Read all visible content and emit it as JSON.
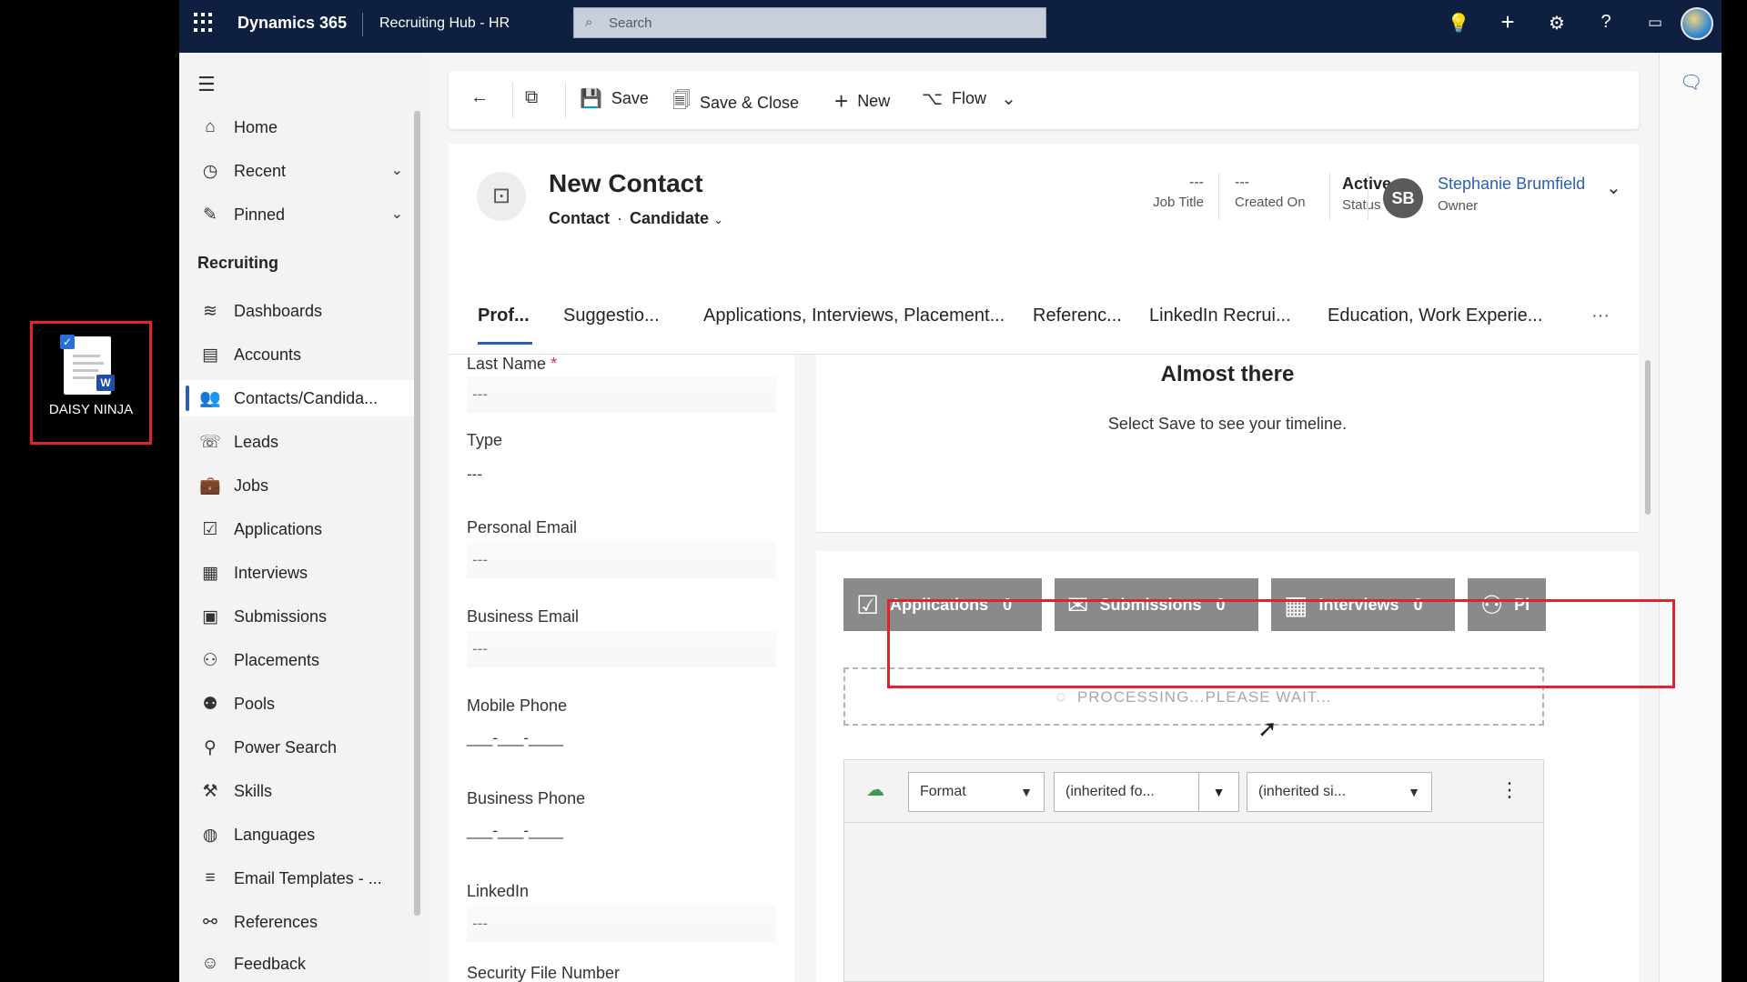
{
  "desktop": {
    "icon_label": "DAISY NINJA"
  },
  "topbar": {
    "brand": "Dynamics 365",
    "app_name": "Recruiting Hub - HR",
    "search_placeholder": "Search"
  },
  "sidebar": {
    "items_top": [
      {
        "label": "Home",
        "icon": "home-icon"
      },
      {
        "label": "Recent",
        "icon": "clock-icon",
        "expandable": true
      },
      {
        "label": "Pinned",
        "icon": "pin-icon",
        "expandable": true
      }
    ],
    "section_title": "Recruiting",
    "items": [
      {
        "label": "Dashboards"
      },
      {
        "label": "Accounts"
      },
      {
        "label": "Contacts/Candida...",
        "active": true
      },
      {
        "label": "Leads"
      },
      {
        "label": "Jobs"
      },
      {
        "label": "Applications"
      },
      {
        "label": "Interviews"
      },
      {
        "label": "Submissions"
      },
      {
        "label": "Placements"
      },
      {
        "label": "Pools"
      },
      {
        "label": "Power Search"
      },
      {
        "label": "Skills"
      },
      {
        "label": "Languages"
      },
      {
        "label": "Email Templates - ..."
      },
      {
        "label": "References"
      },
      {
        "label": "Feedback"
      }
    ]
  },
  "commandbar": {
    "save": "Save",
    "save_close": "Save & Close",
    "new": "New",
    "flow": "Flow"
  },
  "record": {
    "title": "New Contact",
    "entity": "Contact",
    "form": "Candidate",
    "job_title_value": "---",
    "job_title_label": "Job Title",
    "created_on_value": "---",
    "created_on_label": "Created On",
    "status_value": "Active",
    "status_label": "Status",
    "owner_initials": "SB",
    "owner_name": "Stephanie Brumfield",
    "owner_label": "Owner"
  },
  "tabs": [
    "Prof...",
    "Suggestio...",
    "Applications, Interviews, Placement...",
    "Referenc...",
    "LinkedIn Recrui...",
    "Education, Work Experie...",
    "···"
  ],
  "form": {
    "last_name_label": "Last Name",
    "last_name_value": "---",
    "type_label": "Type",
    "type_value": "---",
    "personal_email_label": "Personal Email",
    "personal_email_value": "---",
    "business_email_label": "Business Email",
    "business_email_value": "---",
    "mobile_phone_label": "Mobile Phone",
    "mobile_phone_value": "___-___-____",
    "business_phone_label": "Business Phone",
    "business_phone_value": "___-___-____",
    "linkedin_label": "LinkedIn",
    "linkedin_value": "---",
    "security_label": "Security File Number"
  },
  "timeline": {
    "title": "Almost there",
    "subtitle": "Select Save to see your timeline."
  },
  "widget": {
    "pills": [
      {
        "label": "Applications",
        "count": "0"
      },
      {
        "label": "Submissions",
        "count": "0"
      },
      {
        "label": "Interviews",
        "count": "0"
      },
      {
        "label": "Pl",
        "count": ""
      }
    ],
    "processing": "PROCESSING...PLEASE WAIT...",
    "format_label": "Format",
    "font_label": "(inherited fo...",
    "size_label": "(inherited si..."
  },
  "colors": {
    "topbar": "#0f1f3f",
    "accent": "#2b5fb3",
    "highlight_box": "#e0242b",
    "pill": "#8a8a8a"
  }
}
